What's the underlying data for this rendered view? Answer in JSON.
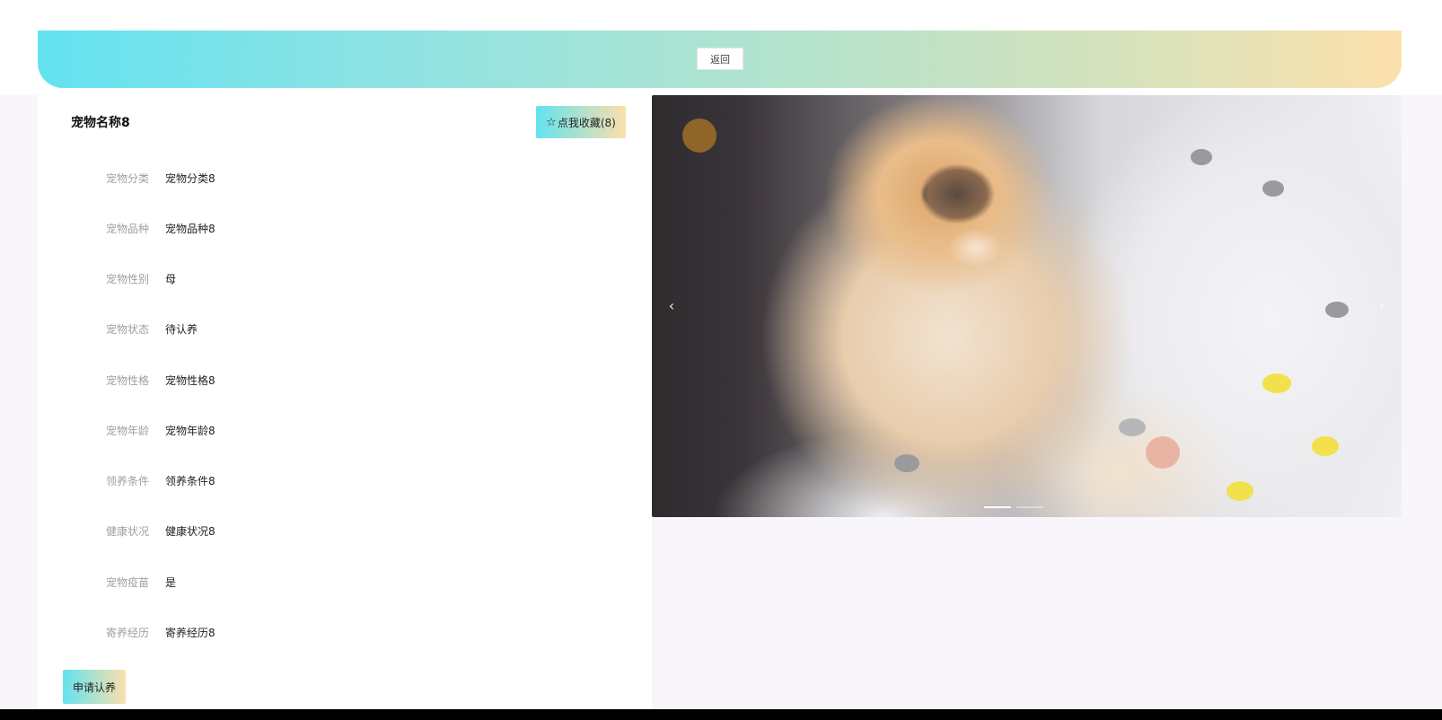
{
  "header": {
    "back_label": "返回"
  },
  "pet": {
    "name": "宠物名称8",
    "favorite_label": "点我收藏(8)",
    "fields": [
      {
        "label": "宠物分类",
        "value": "宠物分类8"
      },
      {
        "label": "宠物品种",
        "value": "宠物品种8"
      },
      {
        "label": "宠物性别",
        "value": "母"
      },
      {
        "label": "宠物状态",
        "value": "待认养"
      },
      {
        "label": "宠物性格",
        "value": "宠物性格8"
      },
      {
        "label": "宠物年龄",
        "value": "宠物年龄8"
      },
      {
        "label": "领养条件",
        "value": "领养条件8"
      },
      {
        "label": "健康状况",
        "value": "健康状况8"
      },
      {
        "label": "宠物疫苗",
        "value": "是"
      },
      {
        "label": "寄养经历",
        "value": "寄养经历8"
      }
    ],
    "adopt_label": "申请认养"
  },
  "carousel": {
    "prev_label": "‹",
    "next_label": "›",
    "icons": {
      "star": "star-outline-icon"
    }
  },
  "colors": {
    "gradient_start": "#63e2f0",
    "gradient_end": "#fce0ab",
    "page_background": "#f8f6fa"
  }
}
